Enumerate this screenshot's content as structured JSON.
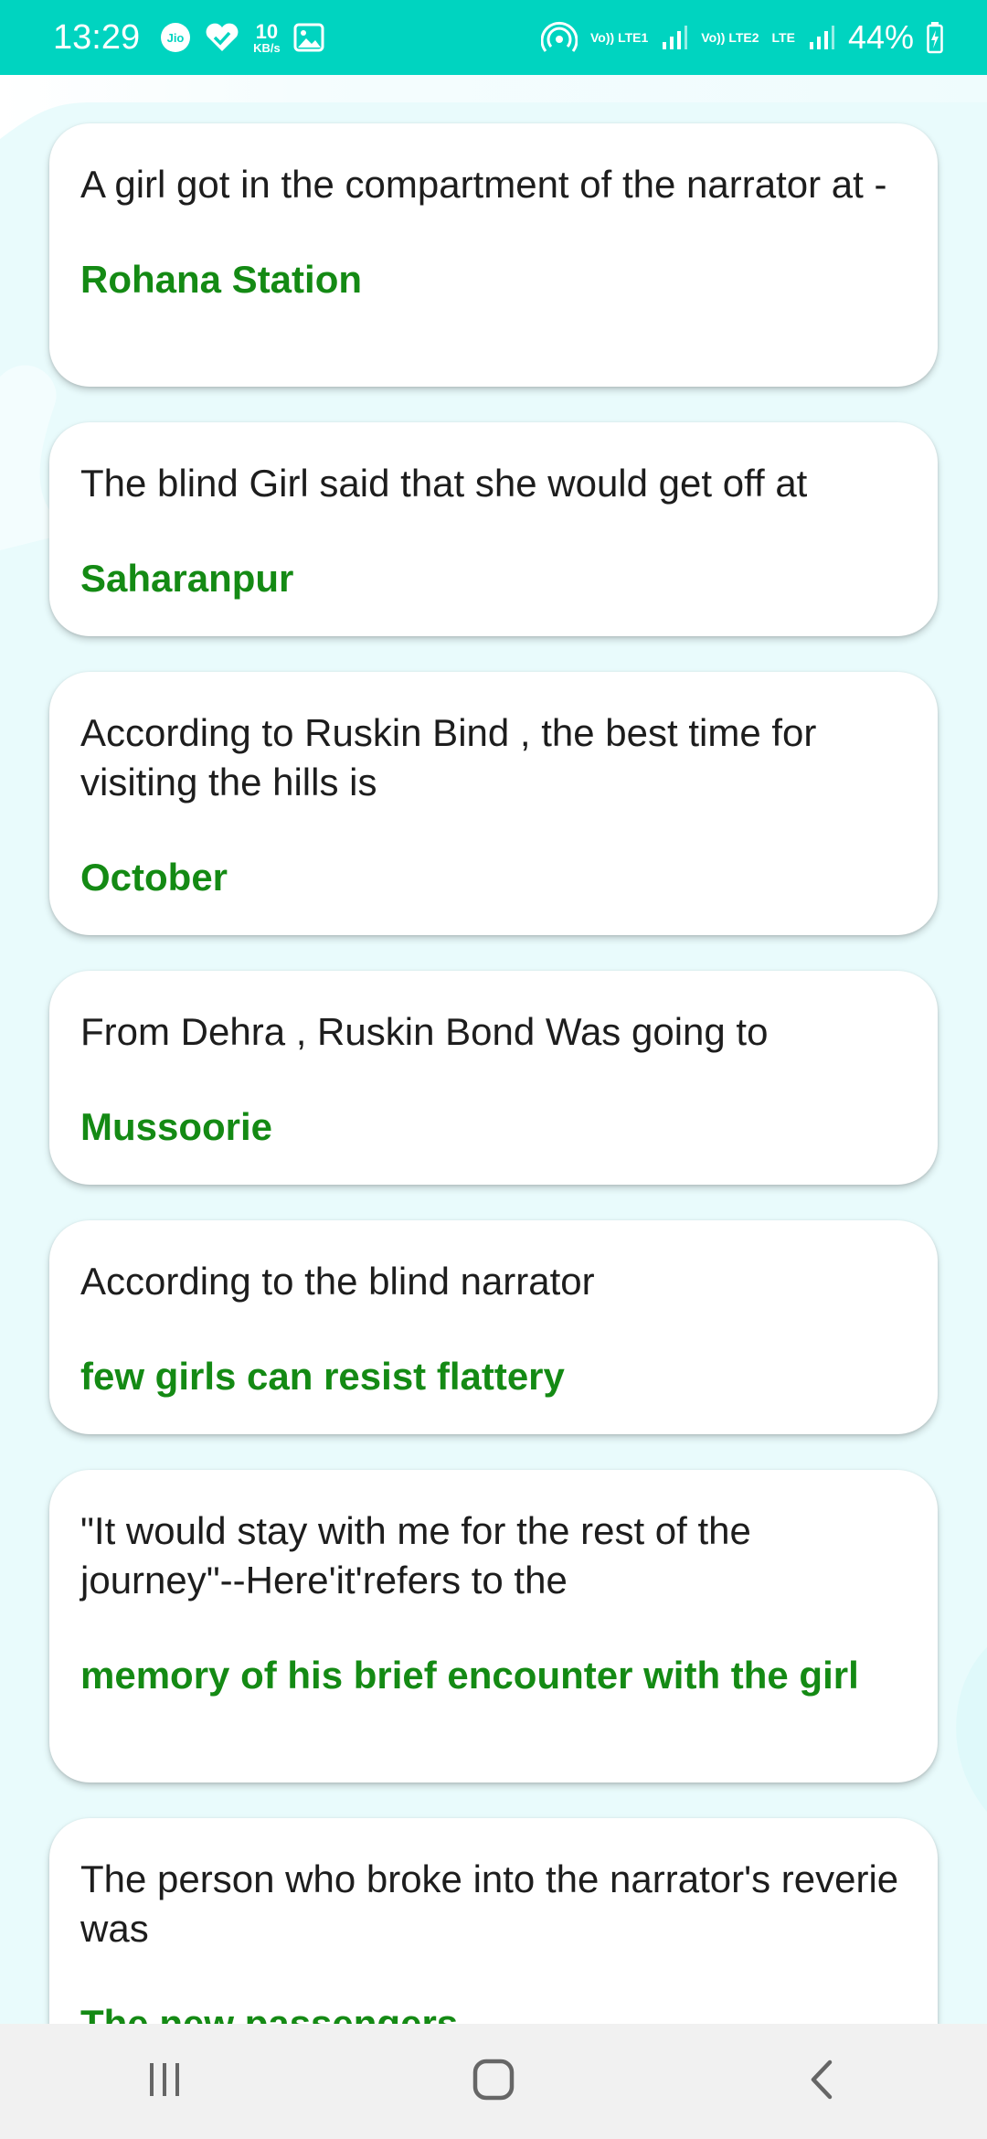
{
  "status_bar": {
    "time": "13:29",
    "speed_value": "10",
    "speed_unit": "KB/s",
    "sim1": "Vo)) LTE1",
    "sim2": "Vo)) LTE2",
    "lte": "LTE",
    "battery": "44%",
    "accent": "#00d4c0"
  },
  "cards": [
    {
      "question": "A girl got in the compartment of the narrator at -",
      "answer": "Rohana Station"
    },
    {
      "question": "The blind Girl said that she would get off at",
      "answer": "Saharanpur"
    },
    {
      "question": "According to Ruskin Bind , the best time for visiting the hills is",
      "answer": "October"
    },
    {
      "question": "From Dehra , Ruskin Bond Was going to",
      "answer": "Mussoorie"
    },
    {
      "question": "According to the blind narrator",
      "answer": "few girls can resist flattery"
    },
    {
      "question": "\"It would stay with me for the rest of the journey\"--Here'it'refers to the",
      "answer": "memory of his brief encounter with the girl"
    },
    {
      "question": "The person who broke into the narrator's reverie was",
      "answer": "The new passengers"
    }
  ],
  "colors": {
    "answer": "#148a14",
    "question": "#1d1d1d"
  },
  "nav": {
    "recent_icon": "recent-apps-icon",
    "home_icon": "home-icon",
    "back_icon": "back-icon"
  }
}
